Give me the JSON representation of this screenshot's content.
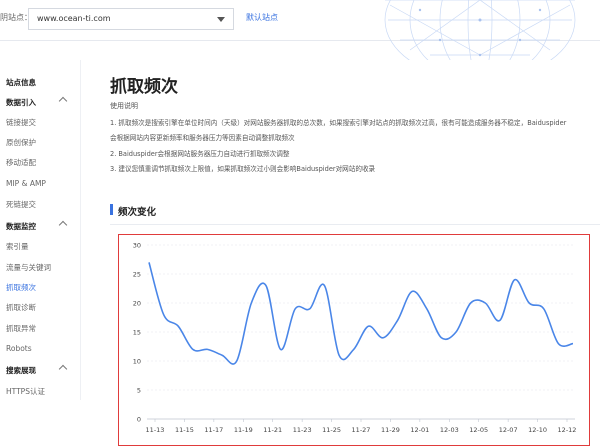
{
  "header": {
    "site_label": "阴站点：",
    "site_value": "www.ocean-ti.com",
    "default_site_link": "默认站点"
  },
  "sidebar": {
    "items": [
      {
        "label": "站点信息",
        "type": "group",
        "chevron": false
      },
      {
        "label": "数据引入",
        "type": "group",
        "chevron": true
      },
      {
        "label": "链接提交",
        "type": "item"
      },
      {
        "label": "原创保护",
        "type": "item"
      },
      {
        "label": "移动适配",
        "type": "item"
      },
      {
        "label": "MIP & AMP",
        "type": "item"
      },
      {
        "label": "死链提交",
        "type": "item"
      },
      {
        "label": "数据监控",
        "type": "group",
        "chevron": true
      },
      {
        "label": "索引量",
        "type": "item"
      },
      {
        "label": "流量与关键词",
        "type": "item"
      },
      {
        "label": "抓取频次",
        "type": "item",
        "active": true
      },
      {
        "label": "抓取诊断",
        "type": "item"
      },
      {
        "label": "抓取异常",
        "type": "item"
      },
      {
        "label": "Robots",
        "type": "item"
      },
      {
        "label": "搜索展现",
        "type": "group",
        "chevron": true
      },
      {
        "label": "HTTPS认证",
        "type": "item"
      }
    ]
  },
  "main": {
    "title": "抓取频次",
    "usage_title": "使用说明",
    "notes": [
      "1. 抓取频次是搜索引擎在单位时间内（天级）对网站服务器抓取的总次数，如果搜索引擎对站点的抓取频次过高，很有可能造成服务器不稳定，Baiduspider",
      "会根据网站内容更新频率和服务器压力等因素自动调整抓取频次",
      "2. Baiduspider会根据网站服务器压力自动进行抓取频次调整",
      "3. 建议您慎重调节抓取频次上限值，如果抓取频次过小则会影响Baiduspider对网站的收录"
    ],
    "section_title": "频次变化"
  },
  "colors": {
    "accent": "#3a73e0",
    "highlight_border": "#e03b3b",
    "line": "#4a86e8"
  },
  "chart_data": {
    "type": "line",
    "title": "",
    "xlabel": "",
    "ylabel": "",
    "ylim": [
      0,
      30
    ],
    "yticks": [
      0,
      5,
      10,
      15,
      20,
      25,
      30
    ],
    "grid": true,
    "x_labels": [
      "11-13",
      "11-15",
      "11-17",
      "11-19",
      "11-21",
      "11-23",
      "11-25",
      "11-27",
      "11-29",
      "12-01",
      "12-03",
      "12-05",
      "12-07",
      "12-10",
      "12-12"
    ],
    "series": [
      {
        "x": [
          "11-13",
          "11-14",
          "11-15",
          "11-16",
          "11-17",
          "11-18",
          "11-19",
          "11-20",
          "11-21",
          "11-22",
          "11-23",
          "11-24",
          "11-25",
          "11-26",
          "11-27",
          "11-28",
          "11-29",
          "11-30",
          "12-01",
          "12-02",
          "12-03",
          "12-04",
          "12-05",
          "12-06",
          "12-07",
          "12-08",
          "12-10",
          "12-11",
          "12-12",
          "12-13"
        ],
        "values": [
          27,
          18,
          16,
          12,
          12,
          11,
          10,
          20,
          23,
          12,
          19,
          19,
          23,
          11,
          12,
          16,
          14,
          17,
          22,
          19,
          14,
          15,
          20,
          20,
          17,
          24,
          20,
          19,
          13,
          13
        ]
      }
    ]
  }
}
